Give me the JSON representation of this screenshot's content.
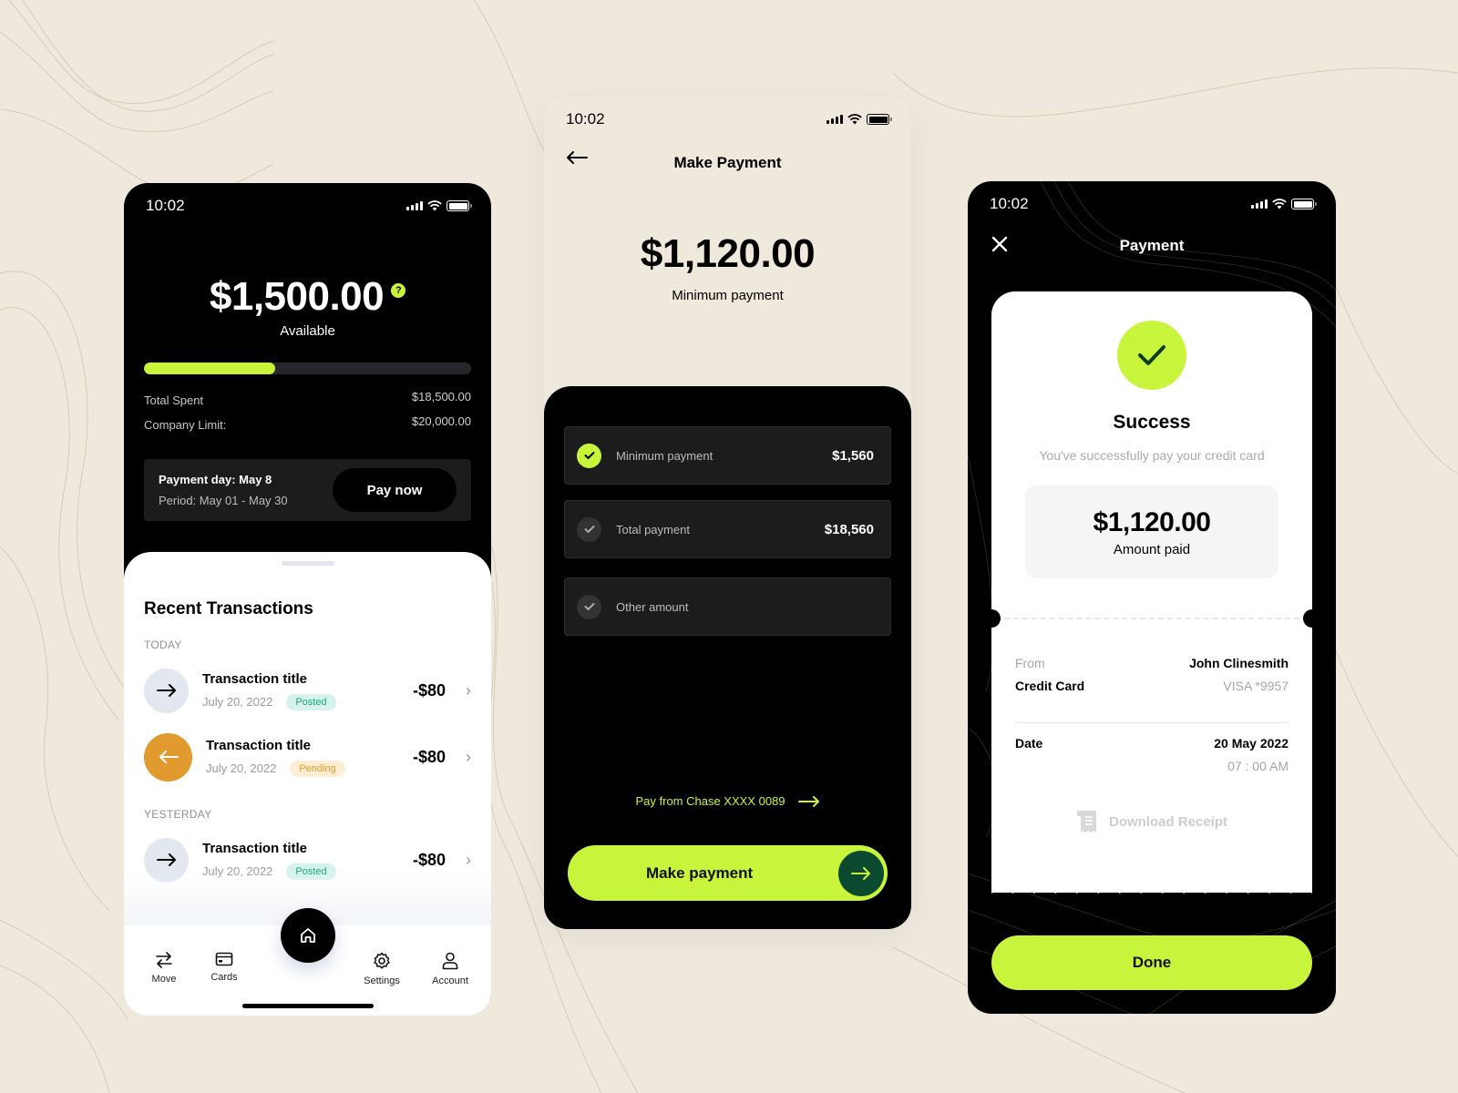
{
  "colors": {
    "accent": "#c8f53b",
    "background": "#efe8dc",
    "dark": "#000000",
    "posted": "#23a47b",
    "pending": "#e09a2e",
    "go_button": "#0b4a2e"
  },
  "home_screen": {
    "status_time": "10:02",
    "balance": "$1,500.00",
    "balance_label": "Available",
    "help_icon": "question-icon",
    "spend_progress_percent": 40,
    "total_spent_label": "Total Spent",
    "total_spent_value": "$18,500.00",
    "company_limit_label": "Company Limit:",
    "company_limit_value": "$20,000.00",
    "payment_day": "Payment day: May 8",
    "period": "Period: May 01 - May 30",
    "pay_now_label": "Pay now",
    "recent_title": "Recent Transactions",
    "sections": [
      {
        "label": "TODAY"
      },
      {
        "label": "YESTERDAY"
      }
    ],
    "transactions": [
      {
        "icon": "arrow-right-icon",
        "title": "Transaction title",
        "date": "July 20, 2022",
        "status": "Posted",
        "amount": "-$80"
      },
      {
        "icon": "arrow-left-icon",
        "title": "Transaction title",
        "date": "July 20, 2022",
        "status": "Pending",
        "amount": "-$80"
      },
      {
        "icon": "arrow-right-icon",
        "title": "Transaction title",
        "date": "July 20, 2022",
        "status": "Posted",
        "amount": "-$80"
      }
    ],
    "tabbar": [
      {
        "icon": "swap-icon",
        "label": "Move"
      },
      {
        "icon": "card-icon",
        "label": "Cards"
      },
      {
        "icon": "home-icon",
        "label": ""
      },
      {
        "icon": "gear-icon",
        "label": "Settings"
      },
      {
        "icon": "user-icon",
        "label": "Account"
      }
    ]
  },
  "make_payment_screen": {
    "status_time": "10:02",
    "title": "Make Payment",
    "amount": "$1,120.00",
    "amount_label": "Minimum payment",
    "options": [
      {
        "label": "Minimum payment",
        "value": "$1,560",
        "selected": true
      },
      {
        "label": "Total payment",
        "value": "$18,560",
        "selected": false
      },
      {
        "label": "Other amount",
        "value": "",
        "selected": false
      }
    ],
    "pay_from": "Pay from Chase XXXX 0089",
    "submit_label": "Make payment"
  },
  "success_screen": {
    "status_time": "10:02",
    "title": "Payment",
    "success_title": "Success",
    "success_subtitle": "You've successfully pay your  credit card",
    "amount": "$1,120.00",
    "amount_label": "Amount paid",
    "from_label": "From",
    "from_value": "John Clinesmith",
    "card_label": "Credit Card",
    "card_value": "VISA *9957",
    "date_label": "Date",
    "date_value": "20 May 2022",
    "time_value": "07 : 00 AM",
    "download_label": "Download Receipt",
    "done_label": "Done"
  }
}
